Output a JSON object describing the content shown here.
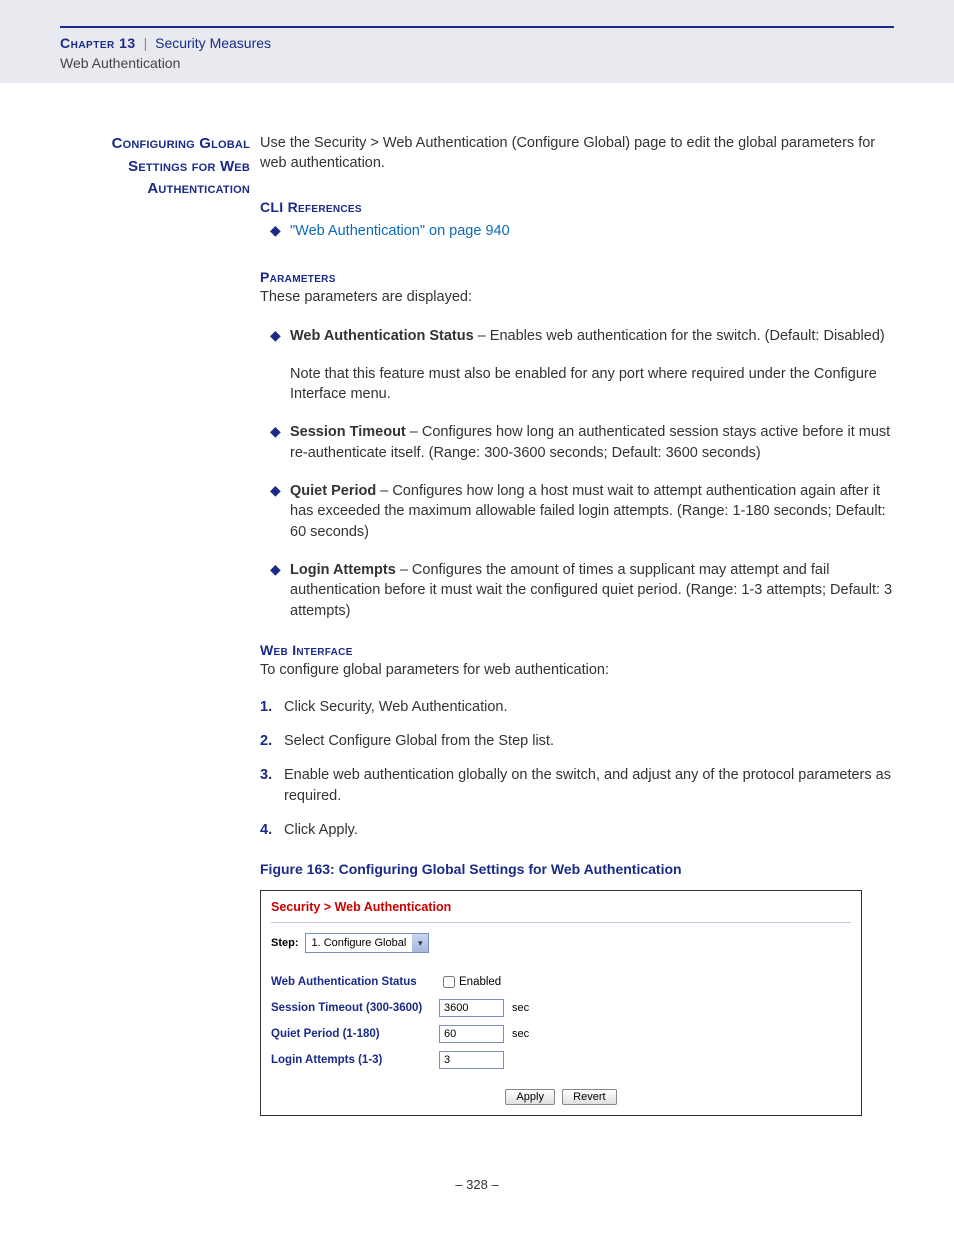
{
  "header": {
    "chapter": "Chapter 13",
    "separator": "|",
    "title": "Security Measures",
    "subtitle": "Web Authentication"
  },
  "section_heading": "Configuring Global Settings for Web Authentication",
  "intro": "Use the Security > Web Authentication (Configure Global) page to edit the global parameters for web authentication.",
  "cli": {
    "heading": "CLI References",
    "link": "\"Web Authentication\" on page 940"
  },
  "parameters": {
    "heading": "Parameters",
    "intro": "These parameters are displayed:",
    "items": [
      {
        "name": "Web Authentication Status",
        "desc": " – Enables web authentication for the switch. (Default: Disabled)",
        "note": "Note that this feature must also be enabled for any port where required under the Configure Interface menu."
      },
      {
        "name": "Session Timeout",
        "desc": " – Configures how long an authenticated session stays active before it must re-authenticate itself. (Range: 300-3600 seconds; Default: 3600 seconds)"
      },
      {
        "name": "Quiet Period",
        "desc": " – Configures how long a host must wait to attempt authentication again after it has exceeded the maximum allowable failed login attempts. (Range: 1-180 seconds; Default: 60 seconds)"
      },
      {
        "name": "Login Attempts",
        "desc": " – Configures the amount of times a supplicant may attempt and fail authentication before it must wait the configured quiet period. (Range: 1-3 attempts; Default: 3 attempts)"
      }
    ]
  },
  "web_interface": {
    "heading": "Web Interface",
    "intro": "To configure global parameters for web authentication:",
    "steps": [
      "Click Security, Web Authentication.",
      "Select Configure Global from the Step list.",
      "Enable web authentication globally on the switch, and adjust any of the protocol parameters as required.",
      "Click Apply."
    ]
  },
  "figure_title": "Figure 163:  Configuring Global Settings for Web Authentication",
  "ui": {
    "breadcrumb": "Security > Web Authentication",
    "step_label": "Step:",
    "step_value": "1. Configure Global",
    "rows": [
      {
        "label": "Web Authentication Status",
        "type": "checkbox",
        "checkbox_label": "Enabled"
      },
      {
        "label": "Session Timeout (300-3600)",
        "type": "text",
        "value": "3600",
        "unit": "sec"
      },
      {
        "label": "Quiet Period (1-180)",
        "type": "text",
        "value": "60",
        "unit": "sec"
      },
      {
        "label": "Login Attempts (1-3)",
        "type": "text",
        "value": "3"
      }
    ],
    "apply": "Apply",
    "revert": "Revert"
  },
  "page_number": "–  328  –"
}
